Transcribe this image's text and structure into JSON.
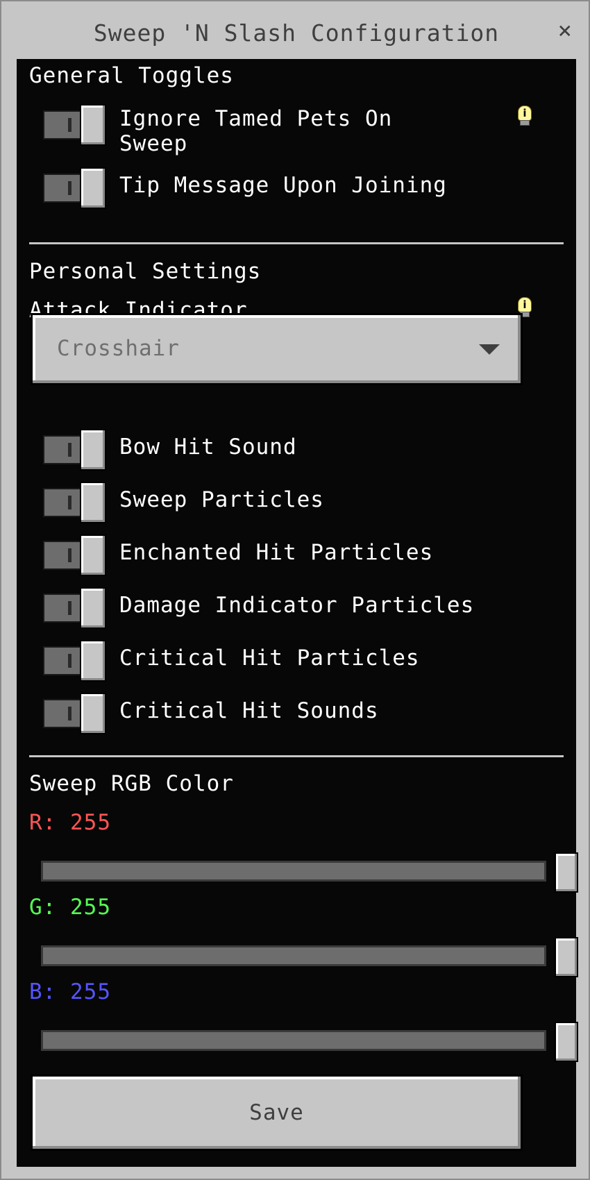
{
  "window": {
    "title": "Sweep 'N Slash Configuration",
    "close_glyph": "×"
  },
  "general": {
    "heading": "General Toggles",
    "toggles": [
      {
        "label_line1": "Ignore Tamed Pets On",
        "label_line2": "Sweep",
        "on": false,
        "has_info": true
      },
      {
        "label": "Tip Message Upon Joining",
        "on": false
      }
    ]
  },
  "personal": {
    "heading": "Personal Settings",
    "attack_indicator_label": "Attack Indicator",
    "attack_indicator_value": "Crosshair",
    "toggles": [
      {
        "label": "Bow Hit Sound",
        "on": false
      },
      {
        "label": "Sweep Particles",
        "on": false
      },
      {
        "label": "Enchanted Hit Particles",
        "on": false
      },
      {
        "label": "Damage Indicator Particles",
        "on": false
      },
      {
        "label": "Critical Hit Particles",
        "on": false
      },
      {
        "label": "Critical Hit Sounds",
        "on": false
      }
    ]
  },
  "color": {
    "heading": "Sweep RGB Color",
    "r": {
      "label": "R: 255",
      "value": 255,
      "max": 255,
      "color": "#ff5555"
    },
    "g": {
      "label": "G: 255",
      "value": 255,
      "max": 255,
      "color": "#55ff55"
    },
    "b": {
      "label": "B: 255",
      "value": 255,
      "max": 255,
      "color": "#5555ff"
    }
  },
  "save_label": "Save",
  "icons": {
    "info": "lightbulb-info-icon",
    "dropdown": "caret-down-icon"
  }
}
